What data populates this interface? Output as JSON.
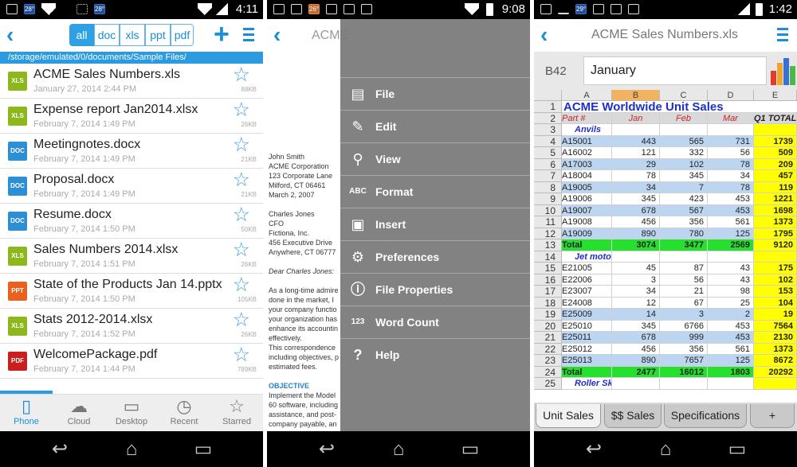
{
  "screen1": {
    "status": {
      "time": "4:11",
      "temp": "28°"
    },
    "filters": [
      "all",
      "doc",
      "xls",
      "ppt",
      "pdf"
    ],
    "path": "/storage/emulated/0/documents/Sample Files/",
    "files": [
      {
        "name": "ACME Sales Numbers.xls",
        "date": "January 27, 2014 2:44 PM",
        "size": "88KB",
        "type": "XLS",
        "color": "#8cb81e"
      },
      {
        "name": "Expense report Jan2014.xlsx",
        "date": "February 7, 2014 1:49 PM",
        "size": "26KB",
        "type": "XLS",
        "color": "#8cb81e"
      },
      {
        "name": "Meetingnotes.docx",
        "date": "February 7, 2014 1:49 PM",
        "size": "21KB",
        "type": "DOC",
        "color": "#2d8fd3"
      },
      {
        "name": "Proposal.docx",
        "date": "February 7, 2014 1:49 PM",
        "size": "21KB",
        "type": "DOC",
        "color": "#2d8fd3"
      },
      {
        "name": "Resume.docx",
        "date": "February 7, 2014 1:50 PM",
        "size": "50KB",
        "type": "DOC",
        "color": "#2d8fd3"
      },
      {
        "name": "Sales Numbers 2014.xlsx",
        "date": "February 7, 2014 1:51 PM",
        "size": "26KB",
        "type": "XLS",
        "color": "#8cb81e"
      },
      {
        "name": "State of the Products Jan 14.pptx",
        "date": "February 7, 2014 1:50 PM",
        "size": "105KB",
        "type": "PPT",
        "color": "#e8611e"
      },
      {
        "name": "Stats 2012-2014.xlsx",
        "date": "February 7, 2014 1:52 PM",
        "size": "26KB",
        "type": "XLS",
        "color": "#8cb81e"
      },
      {
        "name": "WelcomePackage.pdf",
        "date": "February 7, 2014 1:44 PM",
        "size": "789KB",
        "type": "PDF",
        "color": "#c8201e"
      }
    ],
    "tabs": [
      {
        "label": "Phone",
        "icon": "phone-icon",
        "glyph": "▯"
      },
      {
        "label": "Cloud",
        "icon": "cloud-icon",
        "glyph": "☁"
      },
      {
        "label": "Desktop",
        "icon": "desktop-icon",
        "glyph": "▭"
      },
      {
        "label": "Recent",
        "icon": "clock-icon",
        "glyph": "◷"
      },
      {
        "label": "Starred",
        "icon": "star-icon",
        "glyph": "☆"
      }
    ]
  },
  "screen2": {
    "status": {
      "time": "9:08",
      "temp": "26°"
    },
    "title": "ACME",
    "doc_lines": [
      "John Smith",
      "ACME Corporation",
      "123 Corporate Lane",
      "Milford, CT 06461",
      "March 2, 2007",
      "",
      "Charles Jones",
      "CFO",
      "Fictiona, Inc.",
      "456 Executive Drive",
      "Anywhere, CT 06777",
      "",
      "Dear Charles Jones:",
      "",
      "As a long-time admire",
      "done in the market, I",
      "your company functio",
      "your organization has",
      "enhance its accountin",
      "effectively.",
      "This correspondence",
      "including objectives, p",
      "estimated fees.",
      "",
      "OBJECTIVE",
      "Implement the Model",
      "60 software, including",
      "assistance, and post-",
      "company payable, an"
    ],
    "menu": [
      {
        "label": "File",
        "icon": "file-icon",
        "glyph": "▤"
      },
      {
        "label": "Edit",
        "icon": "pencil-icon",
        "glyph": "✎"
      },
      {
        "label": "View",
        "icon": "magnifier-icon",
        "glyph": "⚲"
      },
      {
        "label": "Format",
        "icon": "format-icon",
        "glyph": "ABC"
      },
      {
        "label": "Insert",
        "icon": "insert-icon",
        "glyph": "▣"
      },
      {
        "label": "Preferences",
        "icon": "gear-icon",
        "glyph": "⚙"
      },
      {
        "label": "File Properties",
        "icon": "info-icon",
        "glyph": "ⓘ"
      },
      {
        "label": "Word Count",
        "icon": "word-count-icon",
        "glyph": "123"
      },
      {
        "label": "Help",
        "icon": "help-icon",
        "glyph": "?"
      }
    ]
  },
  "screen3": {
    "status": {
      "time": "1:42",
      "temp": "29°"
    },
    "title": "ACME Sales Numbers.xls",
    "cellref": "B42",
    "formula_value": "January",
    "columns": [
      "A",
      "B",
      "C",
      "D",
      "E"
    ],
    "rows": [
      {
        "n": "1",
        "cells": [
          "ACME Worldwide Unit Sales",
          "",
          "",
          "",
          ""
        ],
        "kind": "title"
      },
      {
        "n": "2",
        "cells": [
          "Part #",
          "Jan",
          "Feb",
          "Mar",
          "Q1 TOTAL"
        ],
        "kind": "header"
      },
      {
        "n": "3",
        "cells": [
          "Anvils",
          "",
          "",
          "",
          ""
        ],
        "kind": "section"
      },
      {
        "n": "4",
        "cells": [
          "A15001",
          "443",
          "565",
          "731",
          "1739"
        ],
        "kind": "blue"
      },
      {
        "n": "5",
        "cells": [
          "A16002",
          "121",
          "332",
          "56",
          "509"
        ],
        "kind": "white"
      },
      {
        "n": "6",
        "cells": [
          "A17003",
          "29",
          "102",
          "78",
          "209"
        ],
        "kind": "blue"
      },
      {
        "n": "7",
        "cells": [
          "A18004",
          "78",
          "345",
          "34",
          "457"
        ],
        "kind": "white"
      },
      {
        "n": "8",
        "cells": [
          "A19005",
          "34",
          "7",
          "78",
          "119"
        ],
        "kind": "blue"
      },
      {
        "n": "9",
        "cells": [
          "A19006",
          "345",
          "423",
          "453",
          "1221"
        ],
        "kind": "white"
      },
      {
        "n": "10",
        "cells": [
          "A19007",
          "678",
          "567",
          "453",
          "1698"
        ],
        "kind": "blue"
      },
      {
        "n": "11",
        "cells": [
          "A19008",
          "456",
          "356",
          "561",
          "1373"
        ],
        "kind": "white"
      },
      {
        "n": "12",
        "cells": [
          "A19009",
          "890",
          "780",
          "125",
          "1795"
        ],
        "kind": "blue"
      },
      {
        "n": "13",
        "cells": [
          "Total",
          "3074",
          "3477",
          "2569",
          "9120"
        ],
        "kind": "total"
      },
      {
        "n": "14",
        "cells": [
          "Jet motors",
          "",
          "",
          "",
          ""
        ],
        "kind": "section"
      },
      {
        "n": "15",
        "cells": [
          "E21005",
          "45",
          "87",
          "43",
          "175"
        ],
        "kind": "white"
      },
      {
        "n": "16",
        "cells": [
          "E22006",
          "3",
          "56",
          "43",
          "102"
        ],
        "kind": "white"
      },
      {
        "n": "17",
        "cells": [
          "E23007",
          "34",
          "21",
          "98",
          "153"
        ],
        "kind": "white"
      },
      {
        "n": "18",
        "cells": [
          "E24008",
          "12",
          "67",
          "25",
          "104"
        ],
        "kind": "white"
      },
      {
        "n": "19",
        "cells": [
          "E25009",
          "14",
          "3",
          "2",
          "19"
        ],
        "kind": "blue"
      },
      {
        "n": "20",
        "cells": [
          "E25010",
          "345",
          "6766",
          "453",
          "7564"
        ],
        "kind": "white"
      },
      {
        "n": "21",
        "cells": [
          "E25011",
          "678",
          "999",
          "453",
          "2130"
        ],
        "kind": "blue"
      },
      {
        "n": "22",
        "cells": [
          "E25012",
          "456",
          "356",
          "561",
          "1373"
        ],
        "kind": "white"
      },
      {
        "n": "23",
        "cells": [
          "E25013",
          "890",
          "7657",
          "125",
          "8672"
        ],
        "kind": "blue"
      },
      {
        "n": "24",
        "cells": [
          "Total",
          "2477",
          "16012",
          "1803",
          "20292"
        ],
        "kind": "total"
      },
      {
        "n": "25",
        "cells": [
          "Roller Skis",
          "",
          "",
          "",
          ""
        ],
        "kind": "section"
      }
    ],
    "sheets": [
      "Unit Sales",
      "$$ Sales",
      "Specifications",
      "+"
    ]
  }
}
